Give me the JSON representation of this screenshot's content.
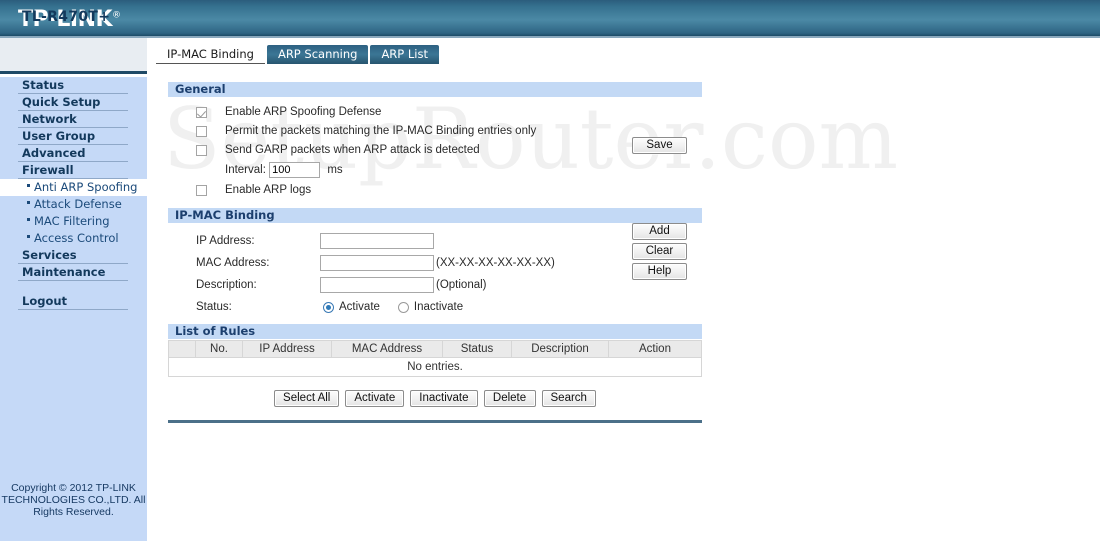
{
  "header": {
    "logo_text": "TP-LINK",
    "logo_reg": "®",
    "model": "TL-R470T+"
  },
  "sidebar": {
    "items": [
      {
        "label": "Status",
        "type": "main"
      },
      {
        "label": "Quick Setup",
        "type": "main"
      },
      {
        "label": "Network",
        "type": "main"
      },
      {
        "label": "User Group",
        "type": "main"
      },
      {
        "label": "Advanced",
        "type": "main"
      },
      {
        "label": "Firewall",
        "type": "main"
      },
      {
        "label": "Anti ARP Spoofing",
        "type": "sub",
        "active": true
      },
      {
        "label": "Attack Defense",
        "type": "sub"
      },
      {
        "label": "MAC Filtering",
        "type": "sub"
      },
      {
        "label": "Access Control",
        "type": "sub"
      },
      {
        "label": "Services",
        "type": "main"
      },
      {
        "label": "Maintenance",
        "type": "main"
      }
    ],
    "logout_label": "Logout",
    "copyright": "Copyright © 2012 TP-LINK TECHNOLOGIES CO.,LTD. All Rights Reserved."
  },
  "watermark": "SetupRouter.com",
  "tabs": [
    {
      "label": "IP-MAC Binding",
      "active": true
    },
    {
      "label": "ARP Scanning",
      "active": false
    },
    {
      "label": "ARP List",
      "active": false
    }
  ],
  "general": {
    "section_title": "General",
    "checkboxes": [
      {
        "label": "Enable ARP Spoofing Defense",
        "checked": true
      },
      {
        "label": "Permit the packets matching the IP-MAC Binding entries only",
        "checked": false
      },
      {
        "label": "Send GARP packets when ARP attack is detected",
        "checked": false
      },
      {
        "label": "Enable ARP logs",
        "checked": false
      }
    ],
    "interval_label": "Interval:",
    "interval_value": "100",
    "interval_unit": "ms",
    "save_label": "Save"
  },
  "binding": {
    "section_title": "IP-MAC Binding",
    "ip_label": "IP Address:",
    "ip_value": "",
    "mac_label": "MAC Address:",
    "mac_value": "",
    "mac_hint": "(XX-XX-XX-XX-XX-XX)",
    "desc_label": "Description:",
    "desc_value": "",
    "desc_hint": "(Optional)",
    "status_label": "Status:",
    "status_activate": "Activate",
    "status_inactivate": "Inactivate",
    "status_selected": "Activate",
    "buttons": [
      "Add",
      "Clear",
      "Help"
    ]
  },
  "rules": {
    "section_title": "List of Rules",
    "columns": [
      "No.",
      "IP Address",
      "MAC Address",
      "Status",
      "Description",
      "Action"
    ],
    "rows": [],
    "empty_text": "No entries.",
    "buttons": [
      "Select All",
      "Activate",
      "Inactivate",
      "Delete",
      "Search"
    ]
  }
}
